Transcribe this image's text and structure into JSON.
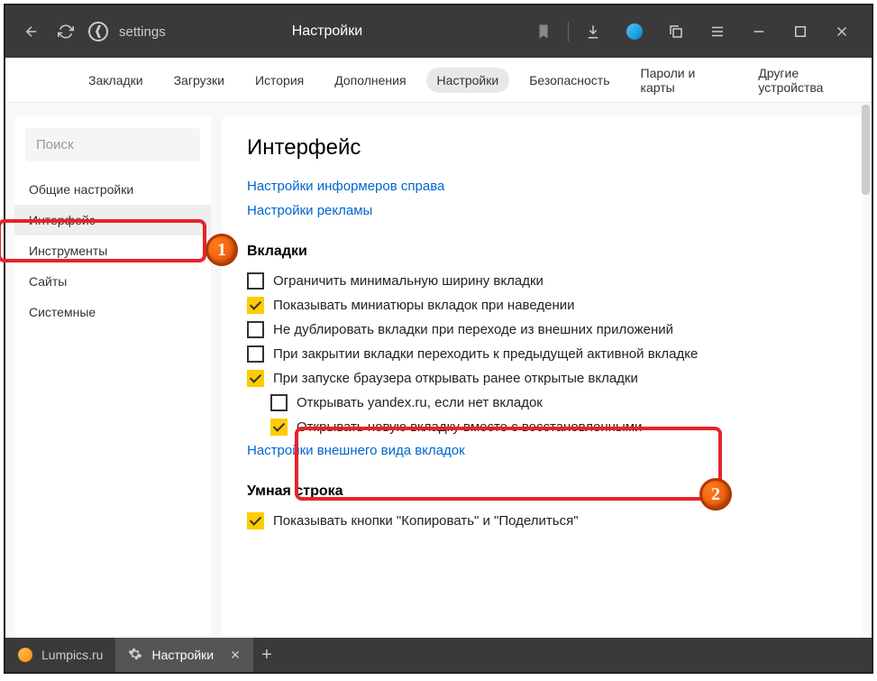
{
  "titlebar": {
    "address": "settings",
    "pageTitle": "Настройки"
  },
  "topnav": {
    "items": [
      "Закладки",
      "Загрузки",
      "История",
      "Дополнения",
      "Настройки",
      "Безопасность",
      "Пароли и карты",
      "Другие устройства"
    ],
    "activeIndex": 4
  },
  "sidebar": {
    "searchPlaceholder": "Поиск",
    "items": [
      "Общие настройки",
      "Интерфейс",
      "Инструменты",
      "Сайты",
      "Системные"
    ],
    "activeIndex": 1
  },
  "main": {
    "heading": "Интерфейс",
    "links": [
      "Настройки информеров справа",
      "Настройки рекламы"
    ],
    "tabsSection": {
      "title": "Вкладки",
      "options": [
        {
          "label": "Ограничить минимальную ширину вкладки",
          "checked": false,
          "indent": false
        },
        {
          "label": "Показывать миниатюры вкладок при наведении",
          "checked": true,
          "indent": false
        },
        {
          "label": "Не дублировать вкладки при переходе из внешних приложений",
          "checked": false,
          "indent": false
        },
        {
          "label": "При закрытии вкладки переходить к предыдущей активной вкладке",
          "checked": false,
          "indent": false
        },
        {
          "label": "При запуске браузера открывать ранее открытые вкладки",
          "checked": true,
          "indent": false
        },
        {
          "label": "Открывать yandex.ru, если нет вкладок",
          "checked": false,
          "indent": true
        },
        {
          "label": "Открывать новую вкладку вместе с восстановленными",
          "checked": true,
          "indent": true
        }
      ],
      "link": "Настройки внешнего вида вкладок"
    },
    "smartSection": {
      "title": "Умная строка",
      "options": [
        {
          "label": "Показывать кнопки \"Копировать\" и \"Поделиться\"",
          "checked": true
        }
      ]
    }
  },
  "bottomTabs": {
    "tabs": [
      {
        "label": "Lumpics.ru",
        "active": false
      },
      {
        "label": "Настройки",
        "active": true
      }
    ]
  },
  "badges": {
    "b1": "1",
    "b2": "2"
  }
}
